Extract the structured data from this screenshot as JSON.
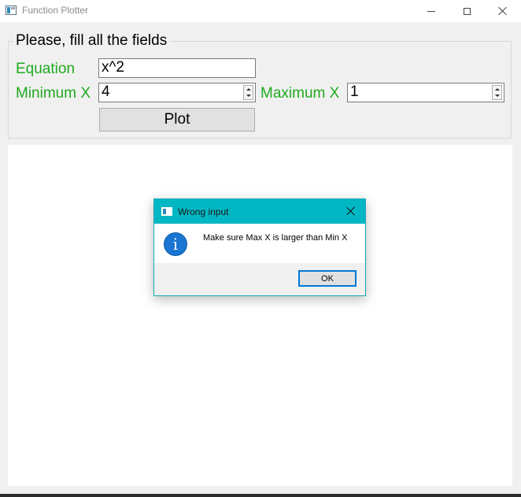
{
  "window": {
    "title": "Function Plotter"
  },
  "form": {
    "group_title": "Please, fill all the fields",
    "equation_label": "Equation",
    "equation_value": "x^2",
    "min_x_label": "Minimum X",
    "min_x_value": "4",
    "max_x_label": "Maximum X",
    "max_x_value": "1",
    "plot_button": "Plot"
  },
  "dialog": {
    "title": "Wrong input",
    "message": "Make sure Max X is larger than Min X",
    "icon": "info-icon",
    "icon_glyph": "i",
    "ok_button": "OK"
  },
  "colors": {
    "label_green": "#1faa1f",
    "dialog_titlebar": "#00b7c3",
    "info_blue": "#1976d2",
    "focus_blue": "#0078d7"
  }
}
